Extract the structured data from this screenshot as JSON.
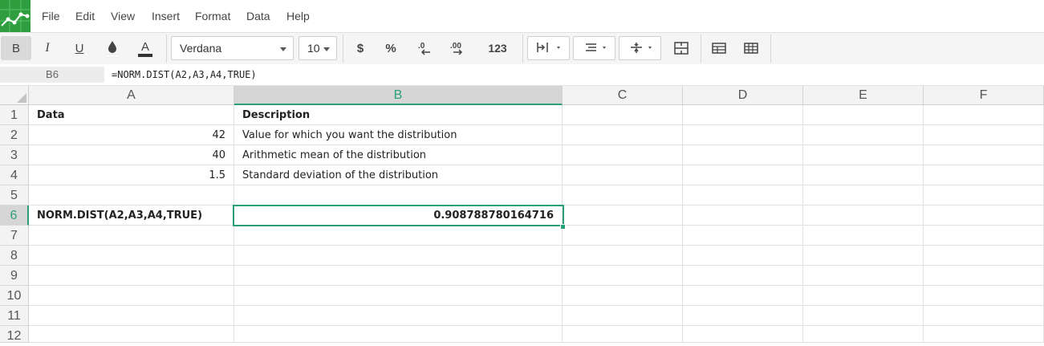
{
  "menu": [
    "File",
    "Edit",
    "View",
    "Insert",
    "Format",
    "Data",
    "Help"
  ],
  "toolbar": {
    "bold": "B",
    "italic": "I",
    "underline": "U",
    "font": "Verdana",
    "size": "10",
    "currency": "$",
    "percent": "%",
    "decrease_decimals": ".0",
    "increase_decimals": ".00",
    "number_format": "123"
  },
  "formula_bar": {
    "cell_ref": "B6",
    "formula": "=NORM.DIST(A2,A3,A4,TRUE)"
  },
  "columns": [
    "A",
    "B",
    "C",
    "D",
    "E",
    "F"
  ],
  "rows": [
    "1",
    "2",
    "3",
    "4",
    "5",
    "6",
    "7",
    "8",
    "9",
    "10",
    "11",
    "12"
  ],
  "cells": {
    "A1": "Data",
    "B1": "Description",
    "A2": "42",
    "B2": "Value for which you want the distribution",
    "A3": "40",
    "B3": "Arithmetic mean of the distribution",
    "A4": "1.5",
    "B4": "Standard deviation of the distribution",
    "A6": "NORM.DIST(A2,A3,A4,TRUE)",
    "B6": "0.908788780164716"
  },
  "selected_cell": "B6",
  "accent_color": "#2aa079",
  "logo_color": "#2e9e3e"
}
